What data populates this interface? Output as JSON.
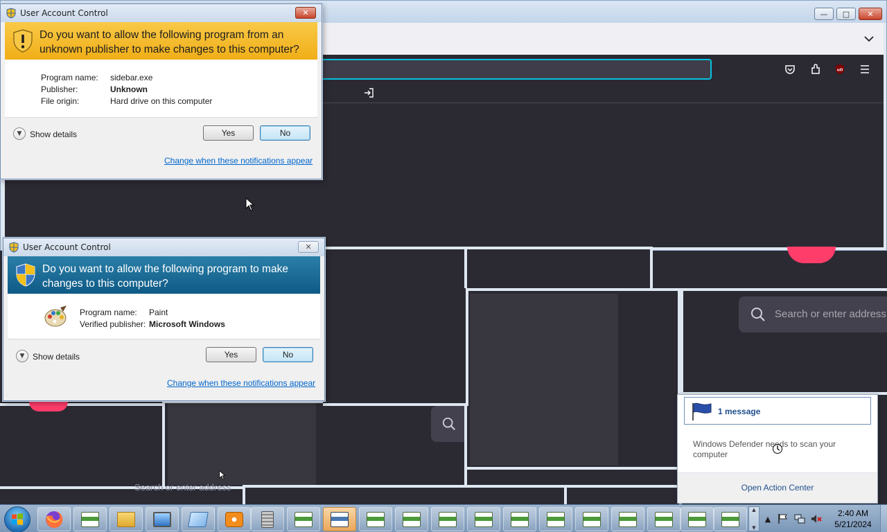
{
  "colors": {
    "firefox_dark": "#2b2a33",
    "uac_yellow": "#f0ae18",
    "uac_blue": "#0f5a86",
    "link_blue": "#0066cc",
    "pocket_pink": "#ff3d6a"
  },
  "firefox": {
    "window_controls": [
      "minimize-icon",
      "maximize-icon",
      "close-icon"
    ],
    "icons": [
      "pocket-icon",
      "extensions-icon",
      "ublock-icon",
      "menu-icon"
    ],
    "search_placeholder": "Search or enter address",
    "ublock_label": "uO"
  },
  "uac1": {
    "title": "User Account Control",
    "question": "Do you want to allow the following program from an unknown publisher to make changes to this computer?",
    "fields": [
      {
        "key": "Program name:",
        "value": "sidebar.exe",
        "bold": false
      },
      {
        "key": "Publisher:",
        "value": "Unknown",
        "bold": true
      },
      {
        "key": "File origin:",
        "value": "Hard drive on this computer",
        "bold": false
      }
    ],
    "show_details": "Show details",
    "yes": "Yes",
    "no": "No",
    "link": "Change when these notifications appear"
  },
  "uac2": {
    "title": "User Account Control",
    "question": "Do you want to allow the following program to make changes to this computer?",
    "fields": [
      {
        "key": "Program name:",
        "value": "Paint",
        "bold": false
      },
      {
        "key": "Verified publisher:",
        "value": "Microsoft Windows",
        "bold": true
      }
    ],
    "show_details": "Show details",
    "yes": "Yes",
    "no": "No",
    "link": "Change when these notifications appear"
  },
  "action_center": {
    "count": "1 message",
    "message": "Windows Defender needs to scan your computer",
    "link": "Open Action Center"
  },
  "taskbar": {
    "clock_time": "2:40 AM",
    "clock_date": "5/21/2024",
    "pinned": [
      "firefox-icon",
      "folder-icon",
      "remote-desktop-icon",
      "notepad-icon",
      "media-player-icon",
      "calculator-icon"
    ],
    "window_count": 13,
    "tray": [
      "show-hidden-icons",
      "action-center-flag-icon",
      "network-icon",
      "volume-muted-icon"
    ]
  },
  "background_text": "Search or enter address"
}
